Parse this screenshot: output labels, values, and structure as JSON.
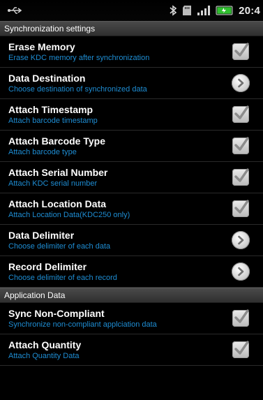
{
  "status_bar": {
    "time": "20:4",
    "icons": [
      "usb-debug-icon",
      "bluetooth-icon",
      "sd-card-icon",
      "signal-icon",
      "battery-icon"
    ]
  },
  "sections": [
    {
      "header": "Synchronization settings",
      "items": [
        {
          "title": "Erase Memory",
          "summary": "Erase KDC memory after synchronization",
          "control": "checkbox",
          "checked": true
        },
        {
          "title": "Data Destination",
          "summary": "Choose destination of synchronized data",
          "control": "arrow"
        },
        {
          "title": "Attach Timestamp",
          "summary": "Attach barcode timestamp",
          "control": "checkbox",
          "checked": true
        },
        {
          "title": "Attach Barcode Type",
          "summary": "Attach barcode type",
          "control": "checkbox",
          "checked": true
        },
        {
          "title": "Attach Serial Number",
          "summary": "Attach KDC serial number",
          "control": "checkbox",
          "checked": true
        },
        {
          "title": "Attach Location Data",
          "summary": "Attach Location Data(KDC250 only)",
          "control": "checkbox",
          "checked": true
        },
        {
          "title": "Data Delimiter",
          "summary": "Choose delimiter of each data",
          "control": "arrow"
        },
        {
          "title": "Record Delimiter",
          "summary": "Choose delimiter of each record",
          "control": "arrow"
        }
      ]
    },
    {
      "header": "Application Data",
      "items": [
        {
          "title": "Sync Non-Compliant",
          "summary": "Synchronize non-compliant applciation data",
          "control": "checkbox",
          "checked": true
        },
        {
          "title": "Attach Quantity",
          "summary": "Attach Quantity Data",
          "control": "checkbox",
          "checked": true
        }
      ]
    }
  ],
  "colors": {
    "summary_text": "#1e8dd3",
    "header_bg": "#3a3a3a",
    "background": "#000000",
    "battery_green": "#2fbf2f"
  }
}
